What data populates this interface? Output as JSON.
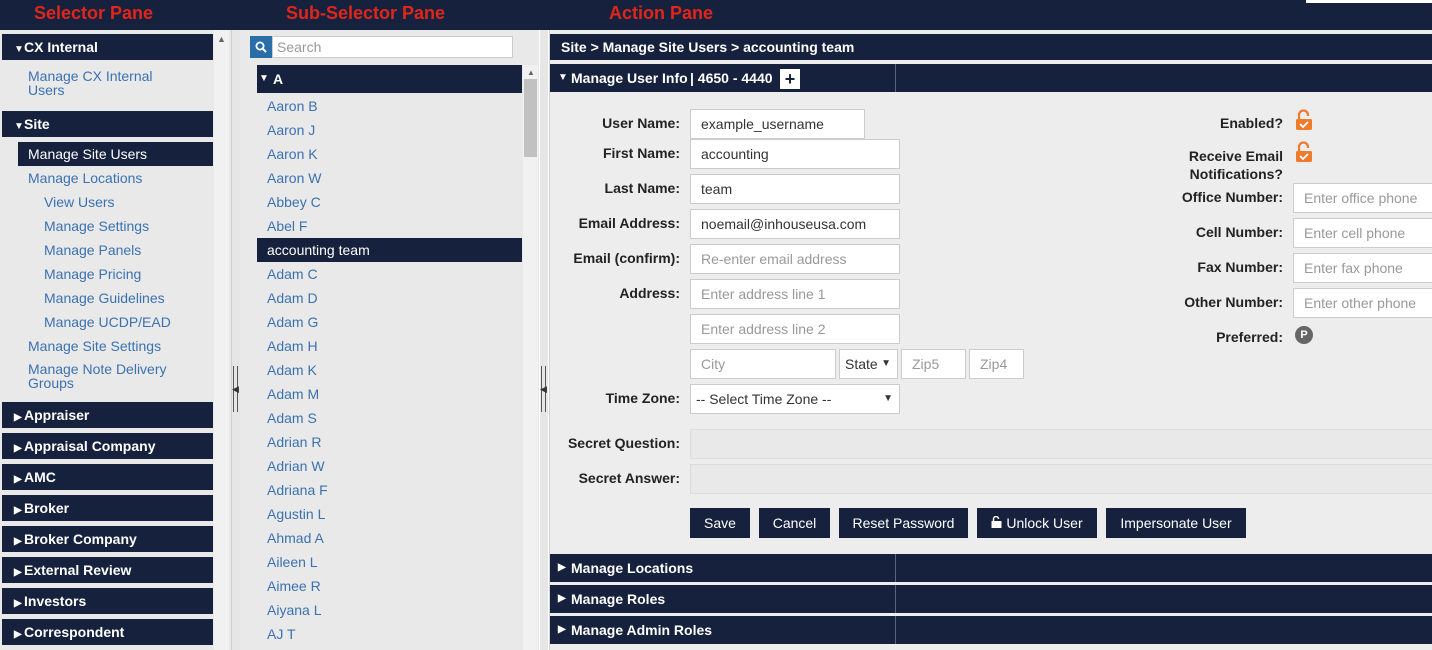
{
  "pane_labels": {
    "selector": "Selector Pane",
    "subselector": "Sub-Selector Pane",
    "action": "Action Pane"
  },
  "selector": {
    "groups": [
      {
        "title": "CX Internal",
        "expanded": true,
        "items": [
          {
            "label": "Manage CX Internal Users"
          }
        ]
      },
      {
        "title": "Site",
        "expanded": true,
        "items": [
          {
            "label": "Manage Site Users",
            "active": true
          },
          {
            "label": "Manage Locations"
          },
          {
            "label": "View Users",
            "sub": true
          },
          {
            "label": "Manage Settings",
            "sub": true
          },
          {
            "label": "Manage Panels",
            "sub": true
          },
          {
            "label": "Manage Pricing",
            "sub": true
          },
          {
            "label": "Manage Guidelines",
            "sub": true
          },
          {
            "label": "Manage UCDP/EAD",
            "sub": true
          },
          {
            "label": "Manage Site Settings"
          },
          {
            "label": "Manage Note Delivery Groups"
          }
        ]
      },
      {
        "title": "Appraiser",
        "expanded": false
      },
      {
        "title": "Appraisal Company",
        "expanded": false
      },
      {
        "title": "AMC",
        "expanded": false
      },
      {
        "title": "Broker",
        "expanded": false
      },
      {
        "title": "Broker Company",
        "expanded": false
      },
      {
        "title": "External Review",
        "expanded": false
      },
      {
        "title": "Investors",
        "expanded": false
      },
      {
        "title": "Correspondent",
        "expanded": false
      }
    ]
  },
  "subselector": {
    "search_placeholder": "Search",
    "group": "A",
    "items": [
      "Aaron B",
      "Aaron J",
      "Aaron K",
      "Aaron W",
      "Abbey C",
      "Abel F",
      "accounting team",
      "Adam C",
      "Adam D",
      "Adam G",
      "Adam H",
      "Adam K",
      "Adam M",
      "Adam S",
      "Adrian R",
      "Adrian W",
      "Adriana F",
      "Agustin L",
      "Ahmad A",
      "Aileen L",
      "Aimee R",
      "Aiyana L",
      "AJ T"
    ],
    "active_item": "accounting team"
  },
  "action": {
    "breadcrumb": "Site > Manage Site Users > accounting team",
    "section": {
      "title": "Manage User Info",
      "ids": "| 4650 - 4440",
      "add_symbol": "+"
    },
    "labels": {
      "user_name": "User Name:",
      "first_name": "First Name:",
      "last_name": "Last Name:",
      "email": "Email Address:",
      "email_confirm": "Email (confirm):",
      "address": "Address:",
      "time_zone": "Time Zone:",
      "secret_question": "Secret Question:",
      "secret_answer": "Secret Answer:",
      "enabled": "Enabled?",
      "receive_email_1": "Receive Email",
      "receive_email_2": "Notifications?",
      "office": "Office Number:",
      "cell": "Cell Number:",
      "fax": "Fax Number:",
      "other": "Other Number:",
      "preferred": "Preferred:"
    },
    "values": {
      "user_name": "example_username",
      "first_name": "accounting",
      "last_name": "team",
      "email": "noemail@inhouseusa.com"
    },
    "placeholders": {
      "email_confirm": "Re-enter email address",
      "address1": "Enter address line 1",
      "address2": "Enter address line 2",
      "city": "City",
      "zip5": "Zip5",
      "zip4": "Zip4",
      "office": "Enter office phone",
      "cell": "Enter cell phone",
      "fax": "Enter fax phone",
      "other": "Enter other phone"
    },
    "state_select": "State",
    "time_zone_select": "-- Select Time Zone --",
    "preferred_badge": "P",
    "buttons": {
      "save": "Save",
      "cancel": "Cancel",
      "reset": "Reset Password",
      "unlock": "Unlock User",
      "impersonate": "Impersonate User"
    },
    "collapsed_sections": [
      "Manage Locations",
      "Manage Roles",
      "Manage Admin Roles"
    ],
    "colors": {
      "navy": "#16223d",
      "link": "#3a72b0",
      "lock": "#ef7b2d",
      "label_red": "#e0261b"
    }
  }
}
